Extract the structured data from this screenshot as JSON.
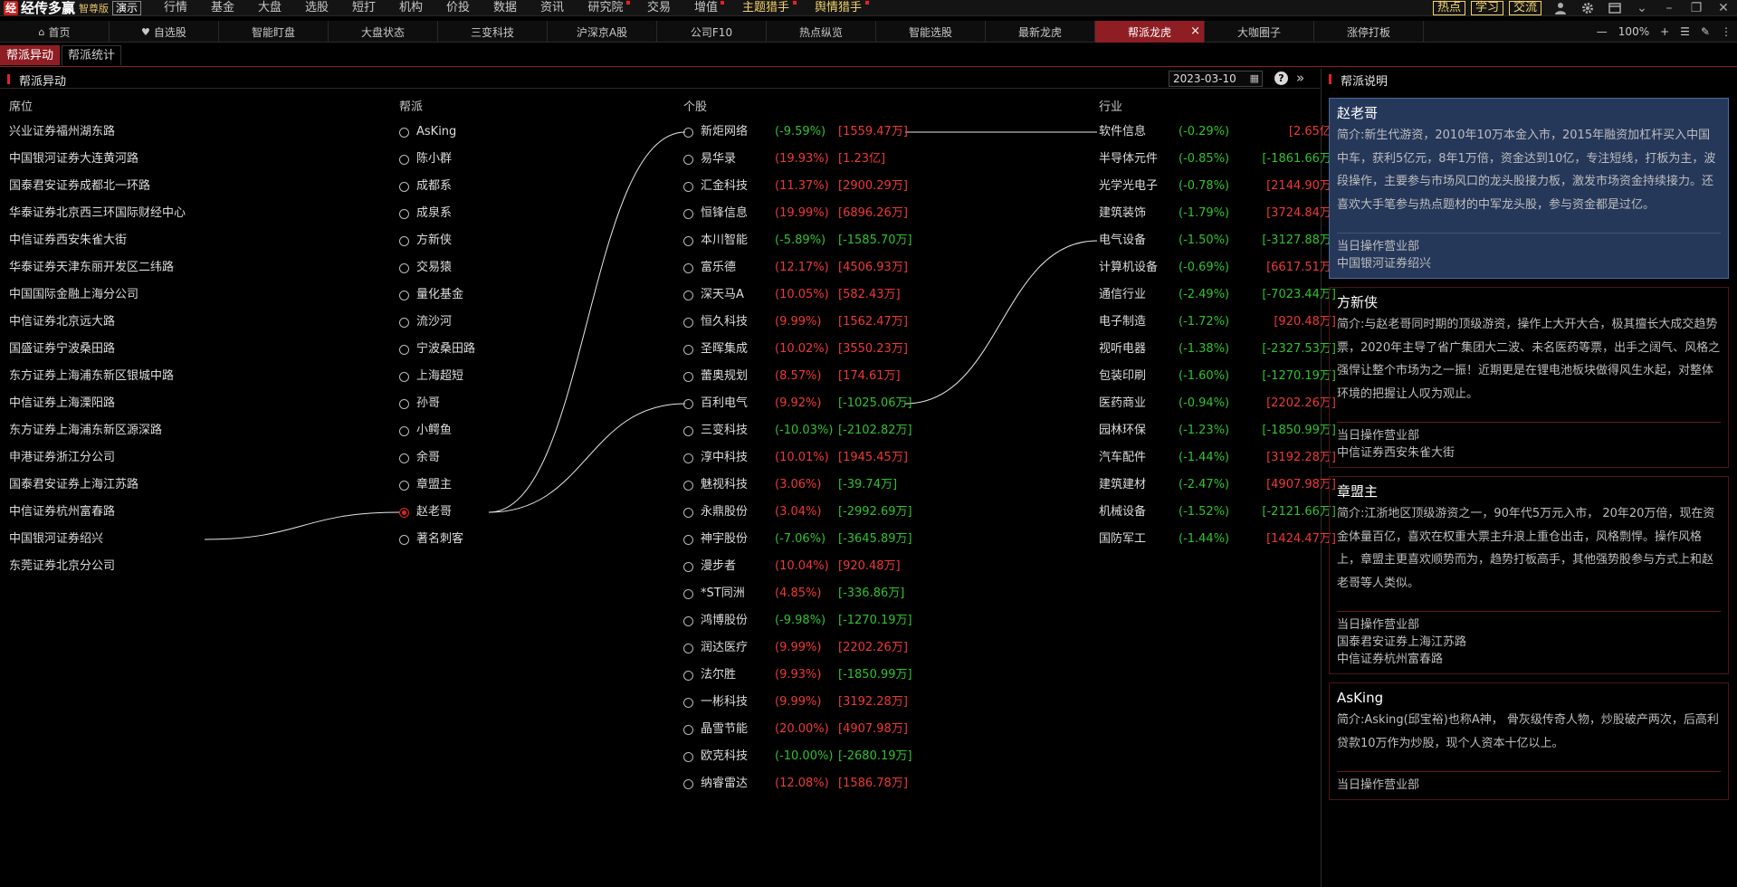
{
  "app": {
    "logo_char": "经",
    "name": "经传多赢",
    "edition": "智尊版",
    "demo": "演示"
  },
  "menu": [
    {
      "label": "行情",
      "dot": false
    },
    {
      "label": "基金",
      "dot": false
    },
    {
      "label": "大盘",
      "dot": false
    },
    {
      "label": "选股",
      "dot": false
    },
    {
      "label": "短打",
      "dot": false
    },
    {
      "label": "机构",
      "dot": false
    },
    {
      "label": "价投",
      "dot": false
    },
    {
      "label": "数据",
      "dot": false
    },
    {
      "label": "资讯",
      "dot": false
    },
    {
      "label": "研究院",
      "dot": true
    },
    {
      "label": "交易",
      "dot": false
    },
    {
      "label": "增值",
      "dot": true
    },
    {
      "label": "主题猎手",
      "dot": true
    },
    {
      "label": "舆情猎手",
      "dot": true
    }
  ],
  "top_right": {
    "hot": "热点",
    "learn": "学习",
    "exchange": "交流"
  },
  "tabs": [
    {
      "label": "首页",
      "icon": "home-icon",
      "active": false
    },
    {
      "label": "自选股",
      "icon": "heart-icon",
      "active": false
    },
    {
      "label": "智能盯盘",
      "active": false
    },
    {
      "label": "大盘状态",
      "active": false
    },
    {
      "label": "三变科技",
      "active": false
    },
    {
      "label": "沪深京A股",
      "active": false
    },
    {
      "label": "公司F10",
      "active": false
    },
    {
      "label": "热点纵览",
      "active": false
    },
    {
      "label": "智能选股",
      "active": false
    },
    {
      "label": "最新龙虎",
      "active": false
    },
    {
      "label": "帮派龙虎",
      "active": true
    },
    {
      "label": "大咖圈子",
      "active": false
    },
    {
      "label": "涨停打板",
      "active": false
    }
  ],
  "zoom": "100%",
  "subtabs": [
    "帮派异动",
    "帮派统计"
  ],
  "panel_title": "帮派异动",
  "date": "2023-03-10",
  "columns": {
    "seat": "席位",
    "gang": "帮派",
    "stock": "个股",
    "industry": "行业"
  },
  "seats": [
    "兴业证券福州湖东路",
    "中国银河证券大连黄河路",
    "国泰君安证券成都北一环路",
    "华泰证券北京西三环国际财经中心",
    "中信证券西安朱雀大街",
    "华泰证券天津东丽开发区二纬路",
    "中国国际金融上海分公司",
    "中信证券北京远大路",
    "国盛证券宁波桑田路",
    "东方证券上海浦东新区银城中路",
    "中信证券上海溧阳路",
    "东方证券上海浦东新区源深路",
    "申港证券浙江分公司",
    "国泰君安证券上海江苏路",
    "中信证券杭州富春路",
    "中国银河证券绍兴",
    "东莞证券北京分公司"
  ],
  "gangs": [
    {
      "name": "AsKing",
      "selected": false
    },
    {
      "name": "陈小群",
      "selected": false
    },
    {
      "name": "成都系",
      "selected": false
    },
    {
      "name": "成泉系",
      "selected": false
    },
    {
      "name": "方新侠",
      "selected": false
    },
    {
      "name": "交易猿",
      "selected": false
    },
    {
      "name": "量化基金",
      "selected": false
    },
    {
      "name": "流沙河",
      "selected": false
    },
    {
      "name": "宁波桑田路",
      "selected": false
    },
    {
      "name": "上海超短",
      "selected": false
    },
    {
      "name": "孙哥",
      "selected": false
    },
    {
      "name": "小鳄鱼",
      "selected": false
    },
    {
      "name": "余哥",
      "selected": false
    },
    {
      "name": "章盟主",
      "selected": false
    },
    {
      "name": "赵老哥",
      "selected": true
    },
    {
      "name": "著名刺客",
      "selected": false
    }
  ],
  "stocks": [
    {
      "name": "新炬网络",
      "pct": "(-9.59%)",
      "amt": "[1559.47万]",
      "pct_up": false,
      "amt_up": true
    },
    {
      "name": "易华录",
      "pct": "(19.93%)",
      "amt": "[1.23亿]",
      "pct_up": true,
      "amt_up": true
    },
    {
      "name": "汇金科技",
      "pct": "(11.37%)",
      "amt": "[2900.29万]",
      "pct_up": true,
      "amt_up": true
    },
    {
      "name": "恒锋信息",
      "pct": "(19.99%)",
      "amt": "[6896.26万]",
      "pct_up": true,
      "amt_up": true
    },
    {
      "name": "本川智能",
      "pct": "(-5.89%)",
      "amt": "[-1585.70万]",
      "pct_up": false,
      "amt_up": false
    },
    {
      "name": "富乐德",
      "pct": "(12.17%)",
      "amt": "[4506.93万]",
      "pct_up": true,
      "amt_up": true
    },
    {
      "name": "深天马A",
      "pct": "(10.05%)",
      "amt": "[582.43万]",
      "pct_up": true,
      "amt_up": true
    },
    {
      "name": "恒久科技",
      "pct": "(9.99%)",
      "amt": "[1562.47万]",
      "pct_up": true,
      "amt_up": true
    },
    {
      "name": "圣晖集成",
      "pct": "(10.02%)",
      "amt": "[3550.23万]",
      "pct_up": true,
      "amt_up": true
    },
    {
      "name": "蕾奥规划",
      "pct": "(8.57%)",
      "amt": "[174.61万]",
      "pct_up": true,
      "amt_up": true
    },
    {
      "name": "百利电气",
      "pct": "(9.92%)",
      "amt": "[-1025.06万]",
      "pct_up": true,
      "amt_up": false
    },
    {
      "name": "三变科技",
      "pct": "(-10.03%)",
      "amt": "[-2102.82万]",
      "pct_up": false,
      "amt_up": false
    },
    {
      "name": "淳中科技",
      "pct": "(10.01%)",
      "amt": "[1945.45万]",
      "pct_up": true,
      "amt_up": true
    },
    {
      "name": "魅视科技",
      "pct": "(3.06%)",
      "amt": "[-39.74万]",
      "pct_up": true,
      "amt_up": false
    },
    {
      "name": "永鼎股份",
      "pct": "(3.04%)",
      "amt": "[-2992.69万]",
      "pct_up": true,
      "amt_up": false
    },
    {
      "name": "神宇股份",
      "pct": "(-7.06%)",
      "amt": "[-3645.89万]",
      "pct_up": false,
      "amt_up": false
    },
    {
      "name": "漫步者",
      "pct": "(10.04%)",
      "amt": "[920.48万]",
      "pct_up": true,
      "amt_up": true
    },
    {
      "name": "*ST同洲",
      "pct": "(4.85%)",
      "amt": "[-336.86万]",
      "pct_up": true,
      "amt_up": false
    },
    {
      "name": "鸿博股份",
      "pct": "(-9.98%)",
      "amt": "[-1270.19万]",
      "pct_up": false,
      "amt_up": false
    },
    {
      "name": "润达医疗",
      "pct": "(9.99%)",
      "amt": "[2202.26万]",
      "pct_up": true,
      "amt_up": true
    },
    {
      "name": "法尔胜",
      "pct": "(9.93%)",
      "amt": "[-1850.99万]",
      "pct_up": true,
      "amt_up": false
    },
    {
      "name": "一彬科技",
      "pct": "(9.99%)",
      "amt": "[3192.28万]",
      "pct_up": true,
      "amt_up": true
    },
    {
      "name": "晶雪节能",
      "pct": "(20.00%)",
      "amt": "[4907.98万]",
      "pct_up": true,
      "amt_up": true
    },
    {
      "name": "欧克科技",
      "pct": "(-10.00%)",
      "amt": "[-2680.19万]",
      "pct_up": false,
      "amt_up": false
    },
    {
      "name": "纳睿雷达",
      "pct": "(12.08%)",
      "amt": "[1586.78万]",
      "pct_up": true,
      "amt_up": true
    }
  ],
  "industries": [
    {
      "name": "软件信息",
      "pct": "(-0.29%)",
      "amt": "[2.65亿]",
      "amt_up": true
    },
    {
      "name": "半导体元件",
      "pct": "(-0.85%)",
      "amt": "[-1861.66万]",
      "amt_up": false
    },
    {
      "name": "光学光电子",
      "pct": "(-0.78%)",
      "amt": "[2144.90万]",
      "amt_up": true
    },
    {
      "name": "建筑装饰",
      "pct": "(-1.79%)",
      "amt": "[3724.84万]",
      "amt_up": true
    },
    {
      "name": "电气设备",
      "pct": "(-1.50%)",
      "amt": "[-3127.88万]",
      "amt_up": false
    },
    {
      "name": "计算机设备",
      "pct": "(-0.69%)",
      "amt": "[6617.51万]",
      "amt_up": true
    },
    {
      "name": "通信行业",
      "pct": "(-2.49%)",
      "amt": "[-7023.44万]",
      "amt_up": false
    },
    {
      "name": "电子制造",
      "pct": "(-1.72%)",
      "amt": "[920.48万]",
      "amt_up": true
    },
    {
      "name": "视听电器",
      "pct": "(-1.38%)",
      "amt": "[-2327.53万]",
      "amt_up": false
    },
    {
      "name": "包装印刷",
      "pct": "(-1.60%)",
      "amt": "[-1270.19万]",
      "amt_up": false
    },
    {
      "name": "医药商业",
      "pct": "(-0.94%)",
      "amt": "[2202.26万]",
      "amt_up": true
    },
    {
      "name": "园林环保",
      "pct": "(-1.23%)",
      "amt": "[-1850.99万]",
      "amt_up": false
    },
    {
      "name": "汽车配件",
      "pct": "(-1.44%)",
      "amt": "[3192.28万]",
      "amt_up": true
    },
    {
      "name": "建筑建材",
      "pct": "(-2.47%)",
      "amt": "[4907.98万]",
      "amt_up": true
    },
    {
      "name": "机械设备",
      "pct": "(-1.52%)",
      "amt": "[-2121.66万]",
      "amt_up": false
    },
    {
      "name": "国防军工",
      "pct": "(-1.44%)",
      "amt": "[1424.47万]",
      "amt_up": true
    }
  ],
  "links": [
    {
      "from": "seat",
      "from_index": 15,
      "to": "gang",
      "to_index": 14
    },
    {
      "from": "gang",
      "from_index": 14,
      "to": "stock",
      "to_index": 0
    },
    {
      "from": "gang",
      "from_index": 14,
      "to": "stock",
      "to_index": 10
    },
    {
      "from": "stock",
      "from_index": 0,
      "to": "industry",
      "to_index": 0
    },
    {
      "from": "stock",
      "from_index": 10,
      "to": "industry",
      "to_index": 4
    }
  ],
  "right_panel": {
    "title": "帮派说明",
    "dept_label": "当日操作营业部",
    "cards": [
      {
        "name": "赵老哥",
        "selected": true,
        "desc": "简介:新生代游资，2010年10万本金入市，2015年融资加杠杆买入中国中车，获利5亿元，8年1万倍，资金达到10亿，专注短线，打板为主，波段操作，主要参与市场风口的龙头股接力板，激发市场资金持续接力。还喜欢大手笔参与热点题材的中军龙头股，参与资金都是过亿。",
        "depts": [
          "中国银河证券绍兴"
        ]
      },
      {
        "name": "方新侠",
        "selected": false,
        "desc": "简介:与赵老哥同时期的顶级游资，操作上大开大合，极其擅长大成交趋势票，2020年主导了省广集团大二波、未名医药等票，出手之阔气、风格之强悍让整个市场为之一振！近期更是在锂电池板块做得风生水起，对整体环境的把握让人叹为观止。",
        "depts": [
          "中信证券西安朱雀大街"
        ]
      },
      {
        "name": "章盟主",
        "selected": false,
        "desc": "简介:江浙地区顶级游资之一，90年代5万元入市， 20年20万倍，现在资金体量百亿，喜欢在权重大票主升浪上重仓出击，风格剽悍。操作风格上，章盟主更喜欢顺势而为，趋势打板高手，其他强势股参与方式上和赵老哥等人类似。",
        "depts": [
          "国泰君安证券上海江苏路",
          "中信证券杭州富春路"
        ]
      },
      {
        "name": "AsKing",
        "selected": false,
        "desc": "简介:Asking(邱宝裕)也称A神， 骨灰级传奇人物，炒股破产两次，后高利贷款10万作为炒股，现个人资本十亿以上。",
        "depts": []
      }
    ]
  },
  "colors": {
    "accent": "#8e1e24",
    "up": "#ee3838",
    "down": "#2fc22f",
    "highlight": "#f2d36b",
    "selected_card": "#26385a"
  }
}
